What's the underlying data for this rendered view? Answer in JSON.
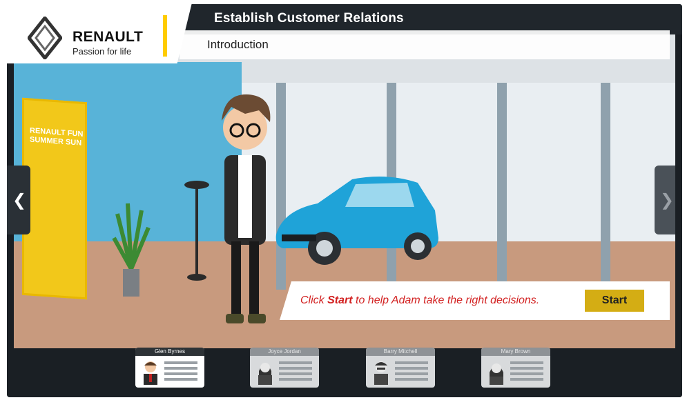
{
  "header": {
    "title": "Establish Customer Relations",
    "subtitle": "Introduction"
  },
  "logo": {
    "brand": "RENAULT",
    "tagline": "Passion for life"
  },
  "poster": {
    "text": "RENAULT FUN SUMMER SUN"
  },
  "callout": {
    "text_before": "Click ",
    "text_bold": "Start",
    "text_after": " to help Adam take the right decisions.",
    "start_label": "Start"
  },
  "characters": [
    {
      "name": "Glen Byrnes",
      "active": true
    },
    {
      "name": "Joyce Jordan",
      "active": false
    },
    {
      "name": "Barry Mitchell",
      "active": false
    },
    {
      "name": "Mary Brown",
      "active": false
    }
  ],
  "colors": {
    "accent": "#ffcc00",
    "button": "#d4ad14",
    "callout_text": "#d21f1f",
    "car": "#1fa3d8"
  },
  "icons": {
    "prev": "chevron-left-icon",
    "next": "chevron-right-icon"
  }
}
